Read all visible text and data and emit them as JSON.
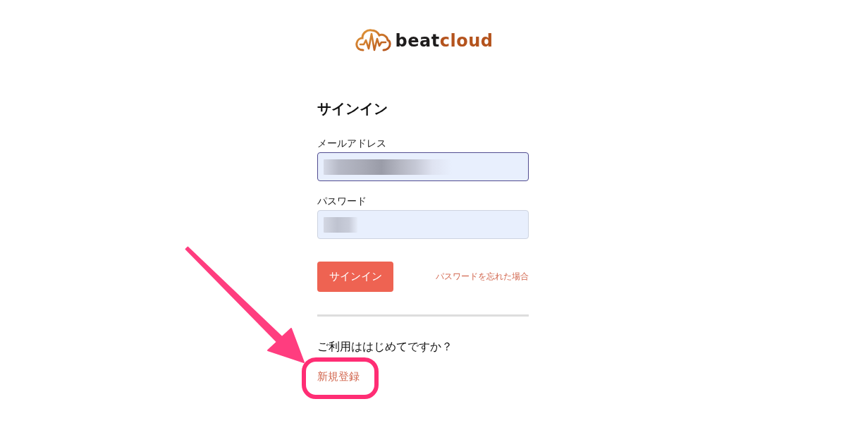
{
  "logo": {
    "text_main": "beat",
    "text_accent": "cloud"
  },
  "form": {
    "title": "サインイン",
    "fields": [
      {
        "kind": "email",
        "label": "メールアドレス",
        "focused": true,
        "blurred": true
      },
      {
        "kind": "password",
        "label": "パスワード",
        "focused": false,
        "blurred": true
      }
    ],
    "submit_button": "サインイン",
    "forgot_link": "パスワードを忘れた場合"
  },
  "signup": {
    "prompt": "ご利用ははじめてですか？",
    "link": "新規登録"
  },
  "annotation": {
    "arrow": true,
    "highlight": true
  }
}
